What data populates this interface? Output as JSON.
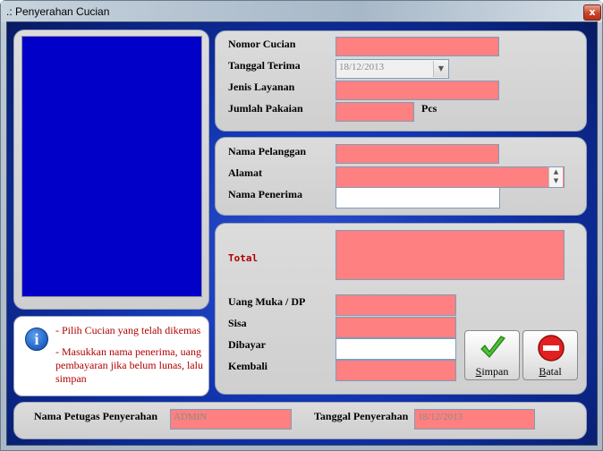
{
  "window": {
    "title": ".: Penyerahan Cucian",
    "close_glyph": "x"
  },
  "order": {
    "nomor_label": "Nomor Cucian",
    "tanggal_label": "Tanggal Terima",
    "tanggal_value": "18/12/2013",
    "jenis_label": "Jenis Layanan",
    "jumlah_label": "Jumlah Pakaian",
    "jumlah_unit": "Pcs"
  },
  "customer": {
    "nama_label": "Nama Pelanggan",
    "alamat_label": "Alamat",
    "penerima_label": "Nama Penerima"
  },
  "payment": {
    "total_label": "Total",
    "uangmuka_label": "Uang Muka / DP",
    "sisa_label": "Sisa",
    "dibayar_label": "Dibayar",
    "kembali_label": "Kembali"
  },
  "info": {
    "icon": "info-icon",
    "line1": "- Pilih Cucian yang telah dikemas",
    "line2": "- Masukkan nama penerima, uang pembayaran jika belum lunas, lalu simpan"
  },
  "buttons": {
    "simpan_hotkey": "S",
    "simpan_rest": "impan",
    "batal_hotkey": "B",
    "batal_rest": "atal"
  },
  "footer": {
    "petugas_label": "Nama Petugas Penyerahan",
    "petugas_value": "ADMIN",
    "tanggal_label": "Tanggal Penyerahan",
    "tanggal_value": "18/12/2013"
  },
  "colors": {
    "field_pink": "#ff8080",
    "client_blue": "#1235b0",
    "image_blue": "#0000c8",
    "info_red": "#b00000"
  }
}
